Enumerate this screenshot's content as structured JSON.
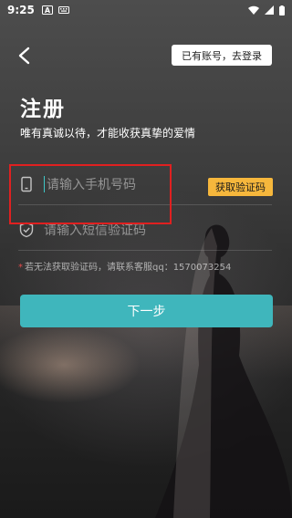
{
  "status_bar": {
    "time": "9:25",
    "icons": [
      "a-notification-icon",
      "keyboard-icon"
    ],
    "right_icons": [
      "wifi-icon",
      "signal-icon",
      "battery-icon"
    ]
  },
  "header": {
    "back_icon": "chevron-left-icon",
    "login_link": "已有账号，去登录"
  },
  "page": {
    "title": "注册",
    "subtitle": "唯有真诚以待，才能收获真挚的爱情"
  },
  "form": {
    "phone": {
      "icon": "phone-icon",
      "placeholder": "请输入手机号码",
      "value": ""
    },
    "get_code_button": "获取验证码",
    "code": {
      "icon": "shield-icon",
      "placeholder": "请输入短信验证码",
      "value": ""
    },
    "help_star": "*",
    "help_text": "若无法获取验证码，请联系客服qq：1570073254",
    "next_button": "下一步"
  },
  "colors": {
    "accent": "#3fb6bc",
    "code_button": "#f6b73c",
    "highlight": "#e02020"
  }
}
